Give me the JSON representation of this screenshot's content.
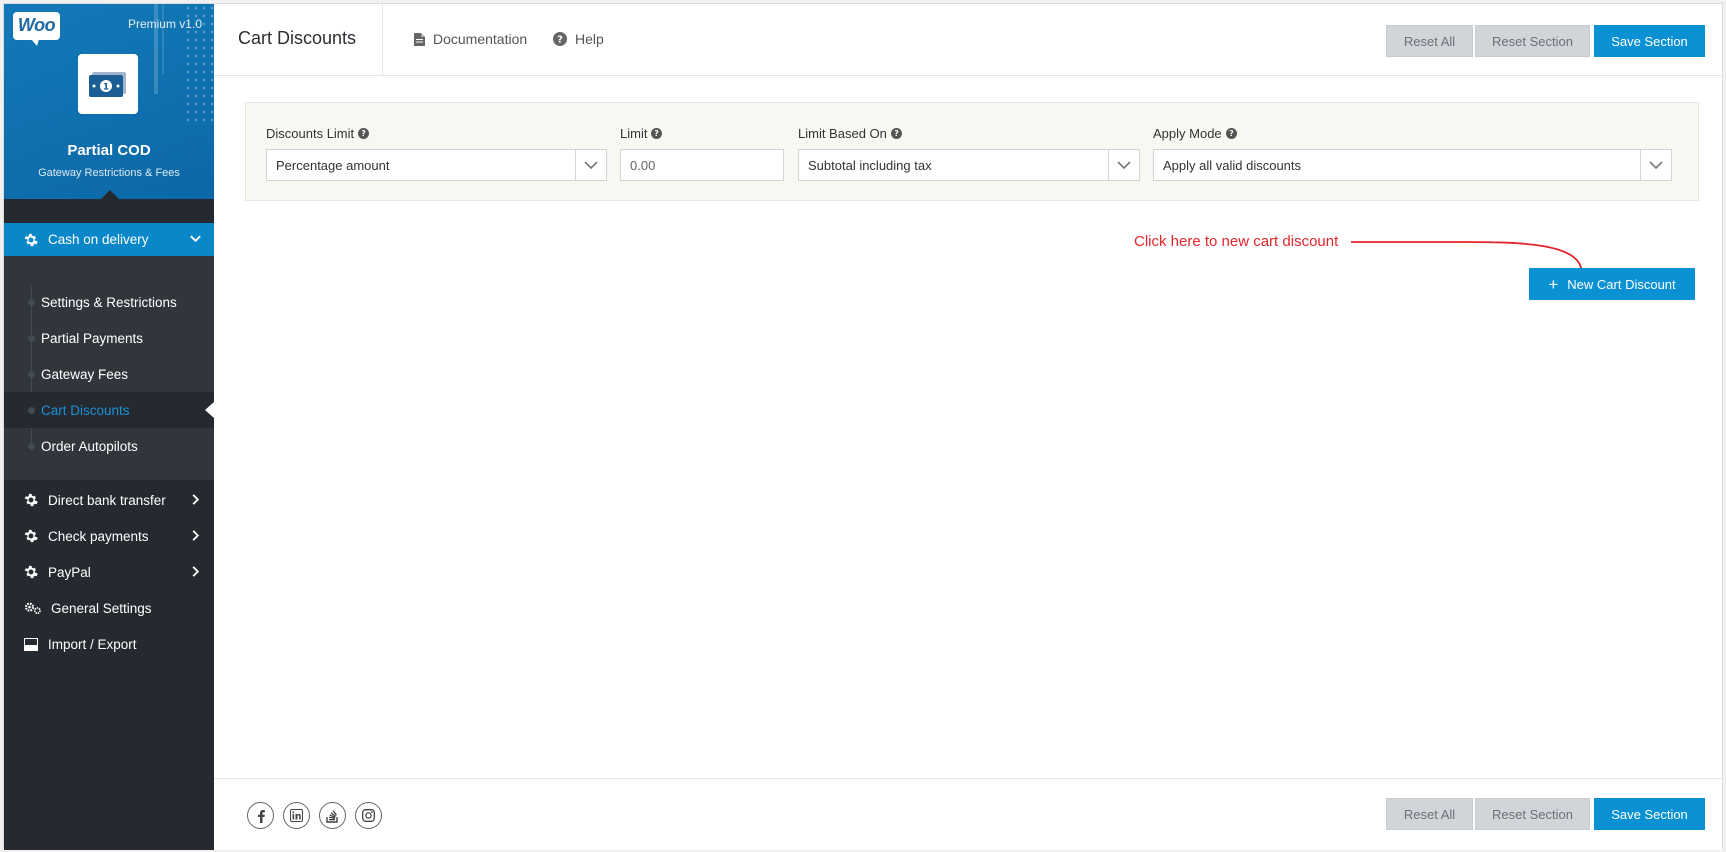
{
  "sidebar": {
    "brand_logo_text": "Woo",
    "premium": "Premium v1.0",
    "plugin_name": "Partial COD",
    "plugin_subtitle": "Gateway Restrictions & Fees",
    "active_gateway": "Cash on delivery",
    "submenu": [
      "Settings & Restrictions",
      "Partial Payments",
      "Gateway Fees",
      "Cart Discounts",
      "Order Autopilots"
    ],
    "active_submenu": "Cart Discounts",
    "menu": [
      {
        "label": "Direct bank transfer",
        "icon": "gear-icon"
      },
      {
        "label": "Check payments",
        "icon": "gear-icon"
      },
      {
        "label": "PayPal",
        "icon": "gear-icon"
      },
      {
        "label": "General Settings",
        "icon": "gears-icon"
      },
      {
        "label": "Import / Export",
        "icon": "import-export-icon"
      }
    ]
  },
  "header": {
    "title": "Cart Discounts",
    "documentation": "Documentation",
    "help": "Help",
    "reset_all": "Reset All",
    "reset_section": "Reset Section",
    "save_section": "Save Section"
  },
  "filters": {
    "discounts_limit": {
      "label": "Discounts Limit",
      "value": "Percentage amount"
    },
    "limit": {
      "label": "Limit",
      "placeholder": "0.00"
    },
    "limit_based_on": {
      "label": "Limit Based On",
      "value": "Subtotal including tax"
    },
    "apply_mode": {
      "label": "Apply Mode",
      "value": "Apply all valid discounts"
    }
  },
  "annotation": "Click here to new cart discount",
  "new_cart_discount": "New Cart Discount",
  "footer": {
    "social": [
      "facebook-icon",
      "linkedin-icon",
      "stackoverflow-icon",
      "instagram-icon"
    ],
    "reset_all": "Reset All",
    "reset_section": "Reset Section",
    "save_section": "Save Section"
  },
  "colors": {
    "accent": "#0a91d4",
    "sidebar_bg": "#252a30",
    "annotation": "#e4262c"
  }
}
